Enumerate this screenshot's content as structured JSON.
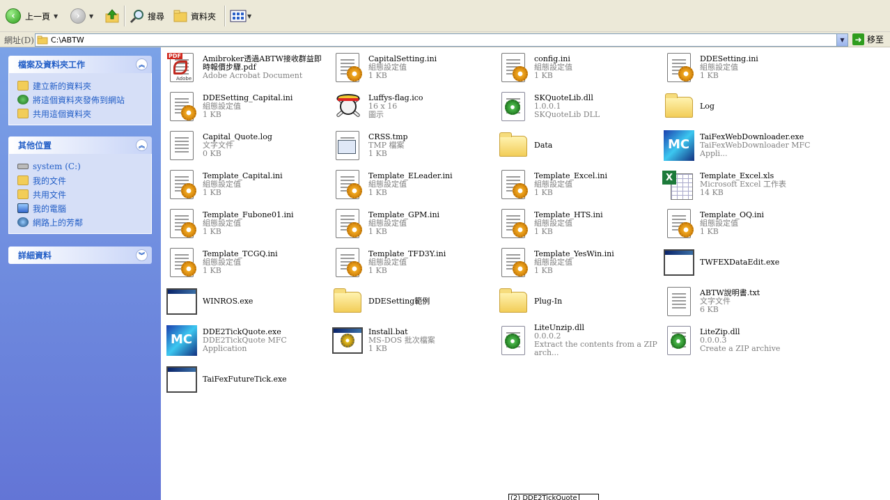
{
  "toolbar": {
    "back_label": "上一頁",
    "search_label": "搜尋",
    "folders_label": "資料夾"
  },
  "address": {
    "label": "網址(D)",
    "path": "C:\\ABTW",
    "go_label": "移至"
  },
  "sidebar": {
    "tasks": {
      "title": "檔案及資料夾工作",
      "items": [
        {
          "label": "建立新的資料夾",
          "icon": "new-folder-icon"
        },
        {
          "label": "將這個資料夾發佈到網站",
          "icon": "publish-web-icon"
        },
        {
          "label": "共用這個資料夾",
          "icon": "share-folder-icon"
        }
      ]
    },
    "places": {
      "title": "其他位置",
      "items": [
        {
          "label": "system (C:)",
          "icon": "drive-icon"
        },
        {
          "label": "我的文件",
          "icon": "my-documents-icon"
        },
        {
          "label": "共用文件",
          "icon": "shared-documents-icon"
        },
        {
          "label": "我的電腦",
          "icon": "my-computer-icon"
        },
        {
          "label": "網路上的芳鄰",
          "icon": "network-places-icon"
        }
      ]
    },
    "details": {
      "title": "詳細資料"
    }
  },
  "files": [
    {
      "name": "Amibroker透過ABTW接收群益即時報價步驟.pdf",
      "line1": "Adobe Acrobat Document",
      "line2": "",
      "type": "pdf"
    },
    {
      "name": "CapitalSetting.ini",
      "line1": "組態設定值",
      "line2": "1 KB",
      "type": "ini"
    },
    {
      "name": "config.ini",
      "line1": "組態設定值",
      "line2": "1 KB",
      "type": "ini"
    },
    {
      "name": "DDESetting.ini",
      "line1": "組態設定值",
      "line2": "1 KB",
      "type": "ini"
    },
    {
      "name": "DDESetting_Capital.ini",
      "line1": "組態設定值",
      "line2": "1 KB",
      "type": "ini"
    },
    {
      "name": "Luffys-flag.ico",
      "line1": "16 x 16",
      "line2": "圖示",
      "type": "ico"
    },
    {
      "name": "SKQuoteLib.dll",
      "line1": "1.0.0.1",
      "line2": "SKQuoteLib DLL",
      "type": "dll"
    },
    {
      "name": "Log",
      "line1": "",
      "line2": "",
      "type": "folder"
    },
    {
      "name": "Capital_Quote.log",
      "line1": "文字文件",
      "line2": "0 KB",
      "type": "txt"
    },
    {
      "name": "CRSS.tmp",
      "line1": "TMP 檔案",
      "line2": "1 KB",
      "type": "tmp"
    },
    {
      "name": "Data",
      "line1": "",
      "line2": "",
      "type": "folder"
    },
    {
      "name": "TaiFexWebDownloader.exe",
      "line1": "TaiFexWebDownloader MFC Appli...",
      "line2": "",
      "type": "mfc"
    },
    {
      "name": "Template_Capital.ini",
      "line1": "組態設定值",
      "line2": "1 KB",
      "type": "ini"
    },
    {
      "name": "Template_ELeader.ini",
      "line1": "組態設定值",
      "line2": "1 KB",
      "type": "ini"
    },
    {
      "name": "Template_Excel.ini",
      "line1": "組態設定值",
      "line2": "1 KB",
      "type": "ini"
    },
    {
      "name": "Template_Excel.xls",
      "line1": "Microsoft Excel 工作表",
      "line2": "14 KB",
      "type": "xls"
    },
    {
      "name": "Template_Fubone01.ini",
      "line1": "組態設定值",
      "line2": "1 KB",
      "type": "ini"
    },
    {
      "name": "Template_GPM.ini",
      "line1": "組態設定值",
      "line2": "1 KB",
      "type": "ini"
    },
    {
      "name": "Template_HTS.ini",
      "line1": "組態設定值",
      "line2": "1 KB",
      "type": "ini"
    },
    {
      "name": "Template_OQ.ini",
      "line1": "組態設定值",
      "line2": "1 KB",
      "type": "ini"
    },
    {
      "name": "Template_TCGQ.ini",
      "line1": "組態設定值",
      "line2": "1 KB",
      "type": "ini"
    },
    {
      "name": "Template_TFD3Y.ini",
      "line1": "組態設定值",
      "line2": "1 KB",
      "type": "ini"
    },
    {
      "name": "Template_YesWin.ini",
      "line1": "組態設定值",
      "line2": "1 KB",
      "type": "ini"
    },
    {
      "name": "TWFEXDataEdit.exe",
      "line1": "",
      "line2": "",
      "type": "exe"
    },
    {
      "name": "WINROS.exe",
      "line1": "",
      "line2": "",
      "type": "exe"
    },
    {
      "name": "DDESetting範例",
      "line1": "",
      "line2": "",
      "type": "folder"
    },
    {
      "name": "Plug-In",
      "line1": "",
      "line2": "",
      "type": "folder"
    },
    {
      "name": "ABTW說明書.txt",
      "line1": "文字文件",
      "line2": "6 KB",
      "type": "txt"
    },
    {
      "name": "DDE2TickQuote.exe",
      "line1": "DDE2TickQuote MFC Application",
      "line2": "",
      "type": "mfc"
    },
    {
      "name": "Install.bat",
      "line1": "MS-DOS 批次檔案",
      "line2": "1 KB",
      "type": "bat"
    },
    {
      "name": "LiteUnzip.dll",
      "line1": "0.0.0.2",
      "line2": "Extract the contents from a ZIP arch...",
      "type": "dll"
    },
    {
      "name": "LiteZip.dll",
      "line1": "0.0.0.3",
      "line2": "Create a ZIP archive",
      "type": "dll"
    },
    {
      "name": "TaiFexFutureTick.exe",
      "line1": "",
      "line2": "",
      "type": "exe"
    }
  ],
  "tooltip": {
    "text": "(2) DDE2TickQuote"
  }
}
